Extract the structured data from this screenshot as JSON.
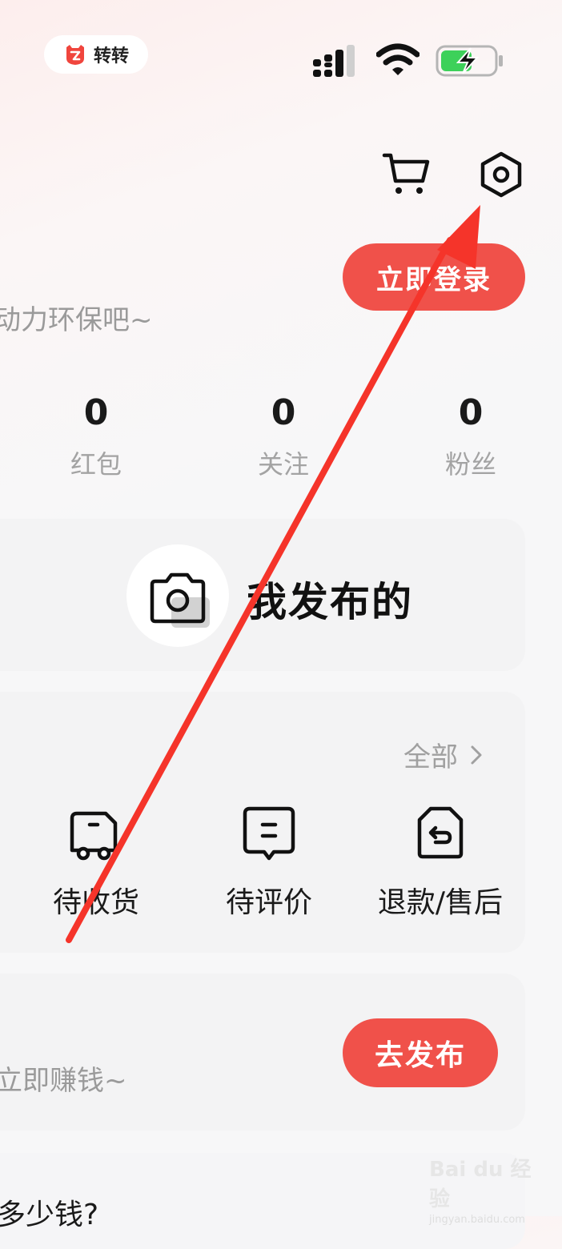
{
  "status_bar": {
    "app_name": "转转",
    "icons": [
      "zhuanzhuan-badge-icon",
      "cellular-signal-icon",
      "wifi-icon",
      "battery-charging-icon"
    ]
  },
  "header": {
    "icons": [
      "shopping-cart-icon",
      "settings-hexagon-icon"
    ]
  },
  "login": {
    "button_label": "立即登录",
    "slogan": "动力环保吧~"
  },
  "stats": [
    {
      "value": "0",
      "label": "红包"
    },
    {
      "value": "0",
      "label": "关注"
    },
    {
      "value": "0",
      "label": "粉丝"
    }
  ],
  "published": {
    "label": "我发布的",
    "icon": "camera-icon"
  },
  "orders": {
    "all_link": "全部",
    "items": [
      {
        "label": "待收货",
        "icon": "delivery-truck-icon"
      },
      {
        "label": "待评价",
        "icon": "comment-bubble-icon"
      },
      {
        "label": "退款/售后",
        "icon": "return-bag-icon"
      }
    ]
  },
  "sell": {
    "text": "立即赚钱~",
    "button_label": "去发布"
  },
  "bottom": {
    "text": "多少钱?"
  },
  "watermark": {
    "logo": "Bai du 经验",
    "url": "jingyan.baidu.com"
  },
  "colors": {
    "accent": "#f0514a",
    "arrow": "#f5342a",
    "card_bg": "#f3f3f4",
    "muted_text": "#9a9a9a"
  }
}
